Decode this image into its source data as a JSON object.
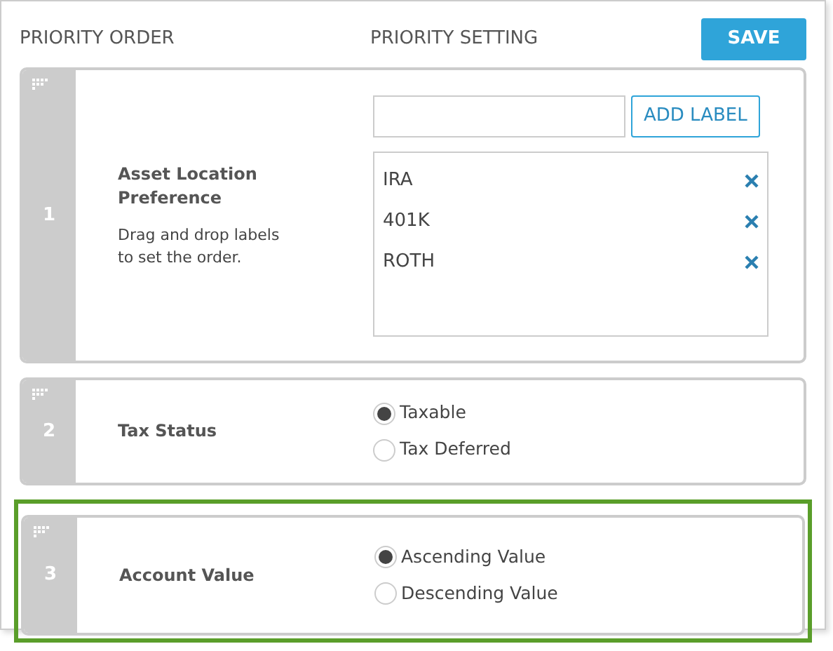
{
  "header": {
    "order_title": "PRIORITY ORDER",
    "setting_title": "PRIORITY SETTING",
    "save_button": "SAVE"
  },
  "priorities": [
    {
      "number": "1",
      "title": "Asset Location Preference",
      "description": "Drag and drop labels to set the order.",
      "highlighted": false,
      "kind": "labels",
      "add_button": "ADD LABEL",
      "labels": [
        "IRA",
        "401K",
        "ROTH"
      ]
    },
    {
      "number": "2",
      "title": "Tax Status",
      "highlighted": false,
      "kind": "radio",
      "options": [
        {
          "label": "Taxable",
          "selected": true
        },
        {
          "label": "Tax Deferred",
          "selected": false
        }
      ]
    },
    {
      "number": "3",
      "title": "Account Value",
      "highlighted": true,
      "kind": "radio",
      "options": [
        {
          "label": "Ascending Value",
          "selected": true
        },
        {
          "label": "Descending Value",
          "selected": false
        }
      ]
    }
  ]
}
